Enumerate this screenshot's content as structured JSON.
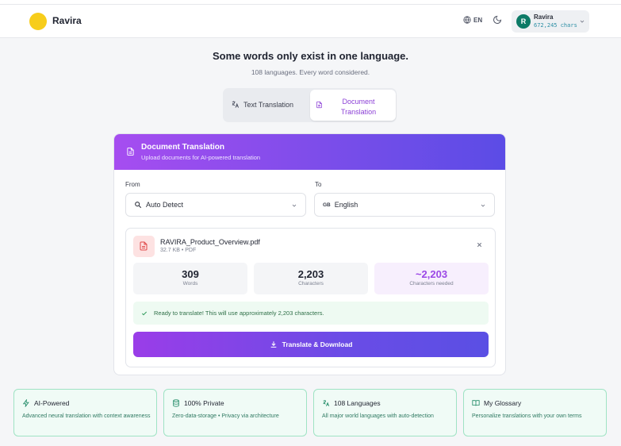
{
  "app": {
    "name": "Ravira"
  },
  "header": {
    "lang_code": "EN",
    "user_name": "Ravira",
    "user_initial": "R",
    "user_chars": "672,245 chars"
  },
  "hero": {
    "title": "Some words only exist in one language.",
    "subtitle": "108 languages. Every word considered."
  },
  "tabs": [
    {
      "label": "Text Translation",
      "active": false
    },
    {
      "label": "Document Translation",
      "active": true
    }
  ],
  "card": {
    "title": "Document Translation",
    "subtitle": "Upload documents for AI-powered translation",
    "from_label": "From",
    "to_label": "To",
    "from_value": "Auto Detect",
    "to_flag": "GB",
    "to_value": "English"
  },
  "file": {
    "name": "RAVIRA_Product_Overview.pdf",
    "meta": "32.7 KB • PDF"
  },
  "stats": [
    {
      "value": "309",
      "caption": "Words"
    },
    {
      "value": "2,203",
      "caption": "Characters"
    },
    {
      "value": "~2,203",
      "caption": "Characters needed"
    }
  ],
  "ready_text": "Ready to translate! This will use approximately 2,203 characters.",
  "translate_button": "Translate & Download",
  "features": [
    {
      "icon": "zap-icon",
      "title": "AI-Powered",
      "desc": "Advanced neural translation with context awareness"
    },
    {
      "icon": "database-icon",
      "title": "100% Private",
      "desc": "Zero-data-storage • Privacy via architecture"
    },
    {
      "icon": "translate-icon",
      "title": "108 Languages",
      "desc": "All major world languages with auto-detection"
    },
    {
      "icon": "book-icon",
      "title": "My Glossary",
      "desc": "Personalize translations with your own terms"
    }
  ],
  "colors": {
    "accent_purple": "#8b3fd6",
    "logo_yellow": "#f7cd1b",
    "avatar_green": "#0c7a66",
    "feature_border": "#9fe3c4"
  }
}
